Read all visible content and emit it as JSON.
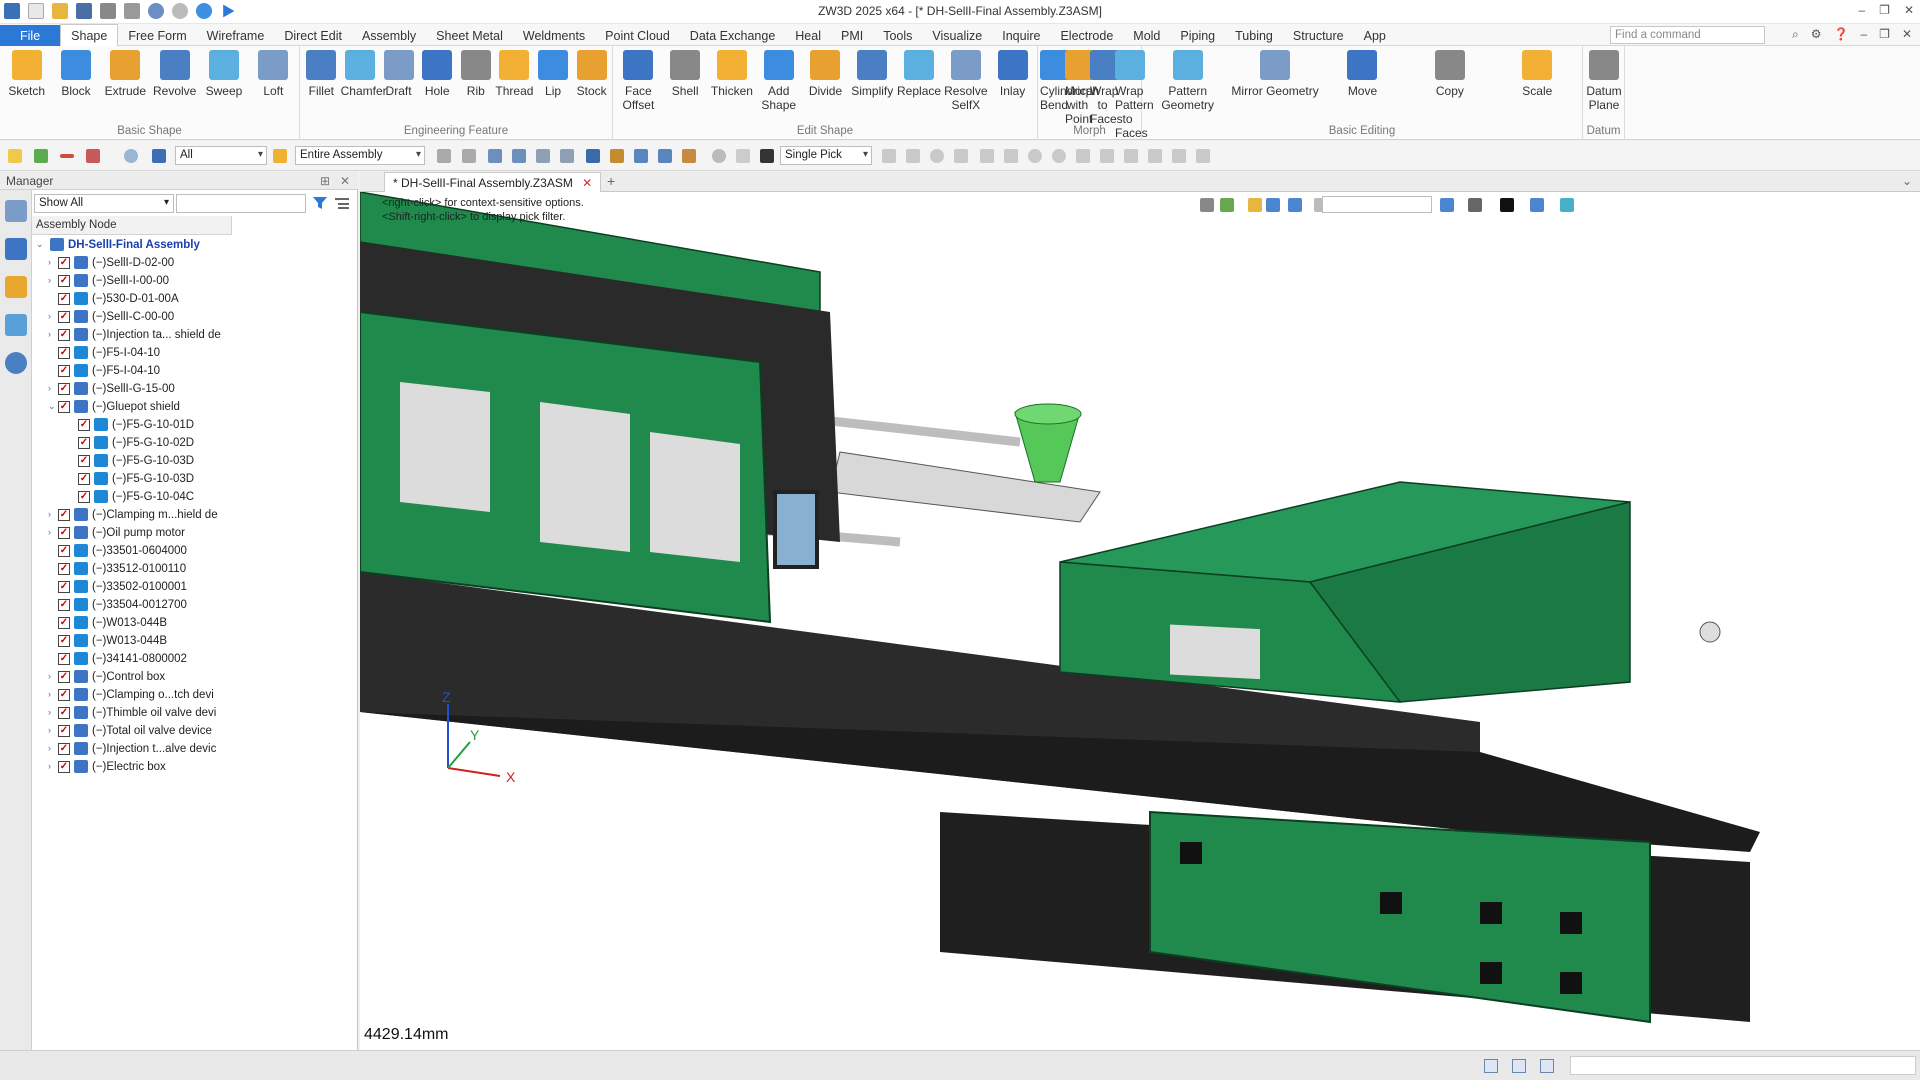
{
  "window": {
    "title": "ZW3D 2025 x64 - [* DH-SellI-Final Assembly.Z3ASM]"
  },
  "menu": {
    "tabs": [
      "File",
      "Shape",
      "Free Form",
      "Wireframe",
      "Direct Edit",
      "Assembly",
      "Sheet Metal",
      "Weldments",
      "Point Cloud",
      "Data Exchange",
      "Heal",
      "PMI",
      "Tools",
      "Visualize",
      "Inquire",
      "Electrode",
      "Mold",
      "Piping",
      "Tubing",
      "Structure",
      "App"
    ],
    "active": "Shape",
    "find_placeholder": "Find a command"
  },
  "ribbon": {
    "groups": [
      {
        "label": "Basic Shape",
        "buttons": [
          "Sketch",
          "Block",
          "Extrude",
          "Revolve",
          "Sweep",
          "Loft"
        ]
      },
      {
        "label": "Engineering Feature",
        "buttons": [
          "Fillet",
          "Chamfer",
          "Draft",
          "Hole",
          "Rib",
          "Thread",
          "Lip",
          "Stock"
        ]
      },
      {
        "label": "Edit Shape",
        "buttons": [
          "Face Offset",
          "Shell",
          "Thicken",
          "Add Shape",
          "Divide",
          "Simplify",
          "Replace",
          "Resolve SelfX",
          "Inlay"
        ]
      },
      {
        "label": "Morph",
        "buttons": [
          "Cylindrical Bend",
          "Morph with Point",
          "Wrap to Faces",
          "Wrap Pattern to Faces"
        ]
      },
      {
        "label": "Basic Editing",
        "buttons": [
          "Pattern Geometry",
          "Mirror Geometry",
          "Move",
          "Copy",
          "Scale"
        ]
      },
      {
        "label": "Datum",
        "buttons": [
          "Datum Plane"
        ]
      }
    ]
  },
  "toolbar": {
    "filter": "All",
    "scope": "Entire Assembly",
    "pick": "Single Pick"
  },
  "manager": {
    "title": "Manager",
    "show": "Show All",
    "column": "Assembly Node",
    "root": "DH-SellI-Final Assembly",
    "items": [
      {
        "label": "(−)SellI-D-02-00",
        "kind": "asm",
        "level": 1,
        "exp": "›"
      },
      {
        "label": "(−)SellI-I-00-00",
        "kind": "asm",
        "level": 1,
        "exp": "›"
      },
      {
        "label": "(−)530-D-01-00A",
        "kind": "part",
        "level": 1,
        "exp": ""
      },
      {
        "label": "(−)SellI-C-00-00",
        "kind": "asm",
        "level": 1,
        "exp": "›"
      },
      {
        "label": "(−)Injection ta... shield de",
        "kind": "asm",
        "level": 1,
        "exp": "›"
      },
      {
        "label": "(−)F5-I-04-10",
        "kind": "part",
        "level": 1,
        "exp": ""
      },
      {
        "label": "(−)F5-I-04-10",
        "kind": "part",
        "level": 1,
        "exp": ""
      },
      {
        "label": "(−)SellI-G-15-00",
        "kind": "asm",
        "level": 1,
        "exp": "›"
      },
      {
        "label": "(−)Gluepot shield",
        "kind": "asm",
        "level": 1,
        "exp": "⌄"
      },
      {
        "label": "(−)F5-G-10-01D",
        "kind": "part",
        "level": 2,
        "exp": ""
      },
      {
        "label": "(−)F5-G-10-02D",
        "kind": "part",
        "level": 2,
        "exp": ""
      },
      {
        "label": "(−)F5-G-10-03D",
        "kind": "part",
        "level": 2,
        "exp": ""
      },
      {
        "label": "(−)F5-G-10-03D",
        "kind": "part",
        "level": 2,
        "exp": ""
      },
      {
        "label": "(−)F5-G-10-04C",
        "kind": "part",
        "level": 2,
        "exp": ""
      },
      {
        "label": "(−)Clamping m...hield de",
        "kind": "asm",
        "level": 1,
        "exp": "›"
      },
      {
        "label": "(−)Oil pump motor",
        "kind": "asm",
        "level": 1,
        "exp": "›"
      },
      {
        "label": "(−)33501-0604000",
        "kind": "part",
        "level": 1,
        "exp": ""
      },
      {
        "label": "(−)33512-0100110",
        "kind": "part",
        "level": 1,
        "exp": ""
      },
      {
        "label": "(−)33502-0100001",
        "kind": "part",
        "level": 1,
        "exp": ""
      },
      {
        "label": "(−)33504-0012700",
        "kind": "part",
        "level": 1,
        "exp": ""
      },
      {
        "label": "(−)W013-044B",
        "kind": "part",
        "level": 1,
        "exp": ""
      },
      {
        "label": "(−)W013-044B",
        "kind": "part",
        "level": 1,
        "exp": ""
      },
      {
        "label": "(−)34141-0800002",
        "kind": "part",
        "level": 1,
        "exp": ""
      },
      {
        "label": "(−)Control box",
        "kind": "asm",
        "level": 1,
        "exp": "›"
      },
      {
        "label": "(−)Clamping o...tch devi",
        "kind": "asm",
        "level": 1,
        "exp": "›"
      },
      {
        "label": "(−)Thimble oil valve devi",
        "kind": "asm",
        "level": 1,
        "exp": "›"
      },
      {
        "label": "(−)Total oil valve device",
        "kind": "asm",
        "level": 1,
        "exp": "›"
      },
      {
        "label": "(−)Injection t...alve devic",
        "kind": "asm",
        "level": 1,
        "exp": "›"
      },
      {
        "label": "(−)Electric box",
        "kind": "asm",
        "level": 1,
        "exp": "›"
      }
    ]
  },
  "document": {
    "tab": "* DH-SellI-Final Assembly.Z3ASM",
    "close": "✕"
  },
  "viewport": {
    "hint1": "<right-click> for context-sensitive options.",
    "hint2": "<Shift-right-click> to display pick filter.",
    "distance": "4429.14mm",
    "axis_x": "X",
    "axis_y": "Y",
    "axis_z": "Z"
  },
  "colors": {
    "accent": "#2b78d6",
    "machine_green": "#1f8a4c",
    "machine_dark": "#2a2a2a"
  }
}
